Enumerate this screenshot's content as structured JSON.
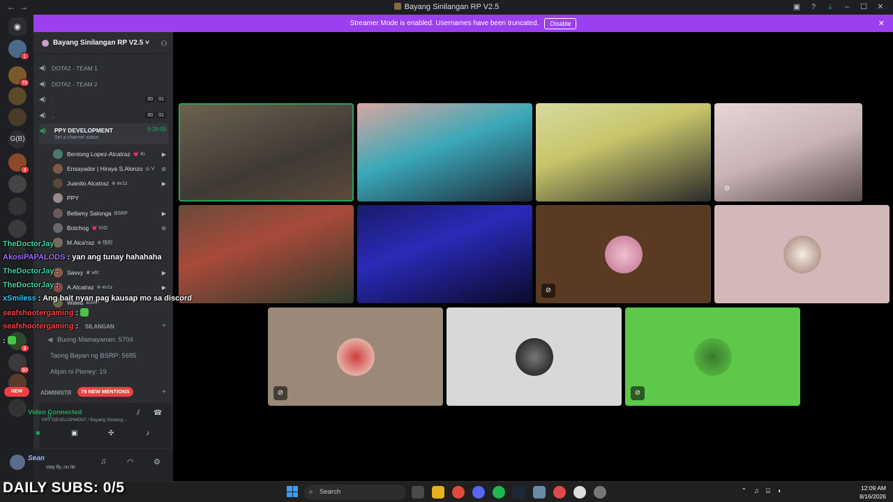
{
  "window": {
    "title": "Bayang Sinilangan RP V2.5"
  },
  "banner": {
    "text": "Streamer Mode is enabled. Usernames have been truncated.",
    "button": "Disable"
  },
  "rail": {
    "discord_home": "◉",
    "text_server": "G(B)",
    "badges": [
      "1",
      "79",
      "3",
      "9",
      "90"
    ],
    "new_pill": "NEW"
  },
  "guild": {
    "name": "Bayang Sinilangan RP V2.5 ˅"
  },
  "voice_channels": [
    {
      "label": "DOTA2 - TEAM 1"
    },
    {
      "label": "DOTA2 - TEAM 2"
    },
    {
      "label": ".",
      "counts": [
        "00",
        "01"
      ]
    },
    {
      "label": "..",
      "counts": [
        "00",
        "01"
      ]
    }
  ],
  "active_channel": {
    "label": "PPY DEVELOPMENT",
    "time": "9:28:09",
    "status": "Set a channel status"
  },
  "members": [
    {
      "name": "Bentong Lopez-Alcatraz",
      "tag": "💗 Ki"
    },
    {
      "name": "Ensayador | Hiraya S.Alonzo",
      "tag": "◎ V"
    },
    {
      "name": "Juanito Alcatraz",
      "tag": "⊛ ʀv1z"
    },
    {
      "name": "PPY",
      "tag": ""
    },
    {
      "name": "Bellamy Salonga",
      "tag": "BSRP"
    },
    {
      "name": "Botchog",
      "tag": "💗 KIO"
    },
    {
      "name": "M.Alca'raz",
      "tag": "⊛ 怪的"
    },
    {
      "name": "Savvy",
      "tag": "♛ wfc"
    },
    {
      "name": "A.Alcatraz",
      "tag": "⊛ ʀv1z"
    },
    {
      "name": "Wawa",
      "tag": "BSRP"
    }
  ],
  "categories": {
    "bayang": "SILANGAN",
    "admin": "ADMINISTR"
  },
  "text_channels": [
    "Buong Mamayanan: 5704",
    "Taong Bayan ng BSRP: 5685",
    "Alipin ni Pioney: 19"
  ],
  "mentions_pill": "79 NEW MENTIONS",
  "voice_panel": {
    "status": "Video Connected",
    "sub": "PPY DEVELOPMENT / Bayang Sinilang..."
  },
  "user": {
    "name": "Sean",
    "sub": "stay fly, no lie"
  },
  "chat": [
    {
      "user": "TheDoctorJay",
      "msg": "",
      "color": "#3fd5a0"
    },
    {
      "user": "AkosiPAPALODS",
      "msg": " : yan ang tunay hahahaha",
      "color": "#a16bff"
    },
    {
      "user": "TheDoctorJay",
      "msg": " :",
      "color": "#3fd5a0"
    },
    {
      "user": "TheDoctorJay",
      "msg": " :",
      "color": "#3fd5a0"
    },
    {
      "user": "xSmiless",
      "msg": " : Ang bait nyan pag kausap mo sa discord",
      "color": "#2ec6ff"
    },
    {
      "user": "seafshootergaming",
      "msg": " :",
      "color": "#ff3d3d"
    },
    {
      "user": "seafshootergaming",
      "msg": " :",
      "color": "#ff3d3d"
    },
    {
      "user": "",
      "msg": " :",
      "color": "#ff3d3d"
    }
  ],
  "overlay": {
    "subs": "DAILY SUBS: 0/5"
  },
  "taskbar": {
    "search": "Search",
    "time": "12:09 AM",
    "date": "8/16/2026"
  },
  "colors": {
    "banner": "#9b3ff0",
    "speaking": "#23a55a",
    "mention": "#f23f43"
  }
}
